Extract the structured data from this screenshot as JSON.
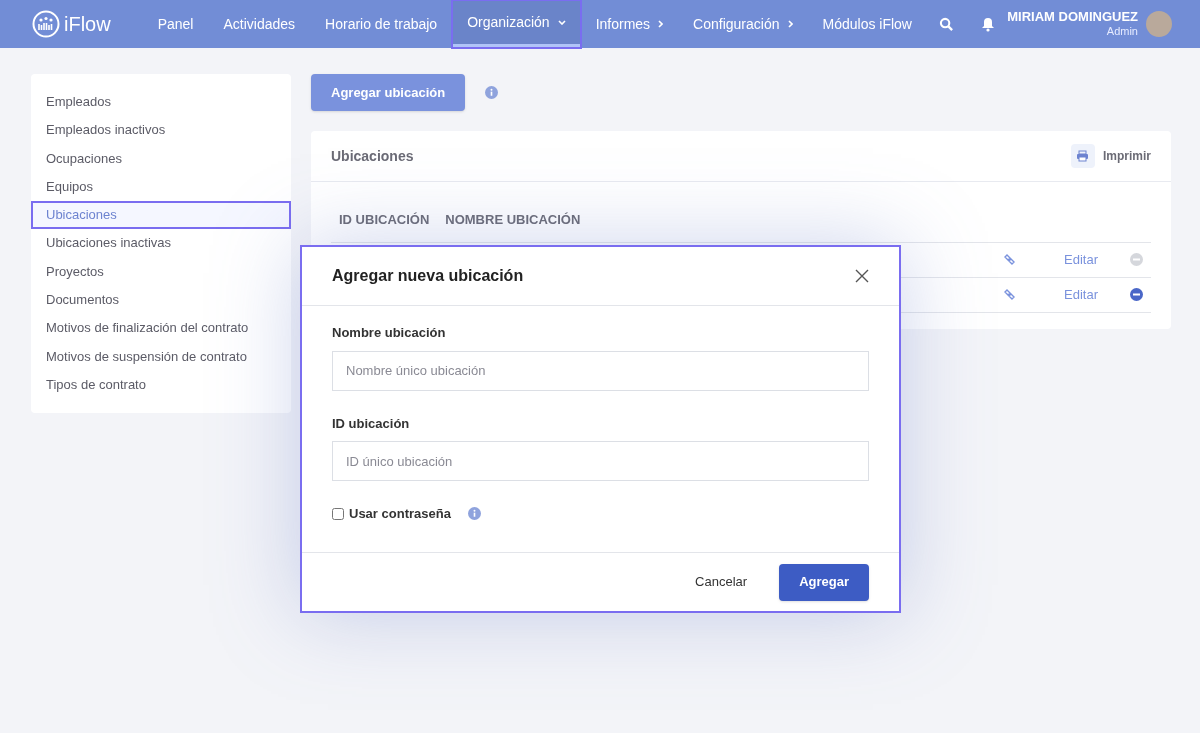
{
  "brand": {
    "name": "iFlow"
  },
  "nav": [
    {
      "label": "Panel",
      "selected": false,
      "kind": "link"
    },
    {
      "label": "Actividades",
      "selected": false,
      "kind": "link"
    },
    {
      "label": "Horario de trabajo",
      "selected": false,
      "kind": "link"
    },
    {
      "label": "Organización",
      "selected": true,
      "kind": "dropdown"
    },
    {
      "label": "Informes",
      "selected": false,
      "kind": "submenu"
    },
    {
      "label": "Configuración",
      "selected": false,
      "kind": "submenu"
    },
    {
      "label": "Módulos iFlow",
      "selected": false,
      "kind": "link"
    }
  ],
  "user": {
    "name": "MIRIAM DOMINGUEZ",
    "role": "Admin"
  },
  "sidebar": {
    "items": [
      {
        "label": "Empleados",
        "selected": false
      },
      {
        "label": "Empleados inactivos",
        "selected": false
      },
      {
        "label": "Ocupaciones",
        "selected": false
      },
      {
        "label": "Equipos",
        "selected": false
      },
      {
        "label": "Ubicaciones",
        "selected": true
      },
      {
        "label": "Ubicaciones inactivas",
        "selected": false
      },
      {
        "label": "Proyectos",
        "selected": false
      },
      {
        "label": "Documentos",
        "selected": false
      },
      {
        "label": "Motivos de finalización del contrato",
        "selected": false
      },
      {
        "label": "Motivos de suspensión de contrato",
        "selected": false
      },
      {
        "label": "Tipos de contrato",
        "selected": false
      }
    ]
  },
  "add_button": "Agregar ubicación",
  "panel": {
    "title": "Ubicaciones",
    "print": "Imprimir",
    "columns": [
      "ID UBICACIÓN",
      "NOMBRE UBICACIÓN"
    ],
    "rows": [
      {
        "edit": "Editar",
        "remove_enabled": false
      },
      {
        "edit": "Editar",
        "remove_enabled": true
      }
    ]
  },
  "modal": {
    "title": "Agregar nueva ubicación",
    "fields": [
      {
        "label": "Nombre ubicación",
        "placeholder": "Nombre único ubicación"
      },
      {
        "label": "ID ubicación",
        "placeholder": "ID único ubicación"
      }
    ],
    "checkbox": {
      "label": "Usar contraseña",
      "checked": false
    },
    "cancel": "Cancelar",
    "submit": "Agregar"
  }
}
